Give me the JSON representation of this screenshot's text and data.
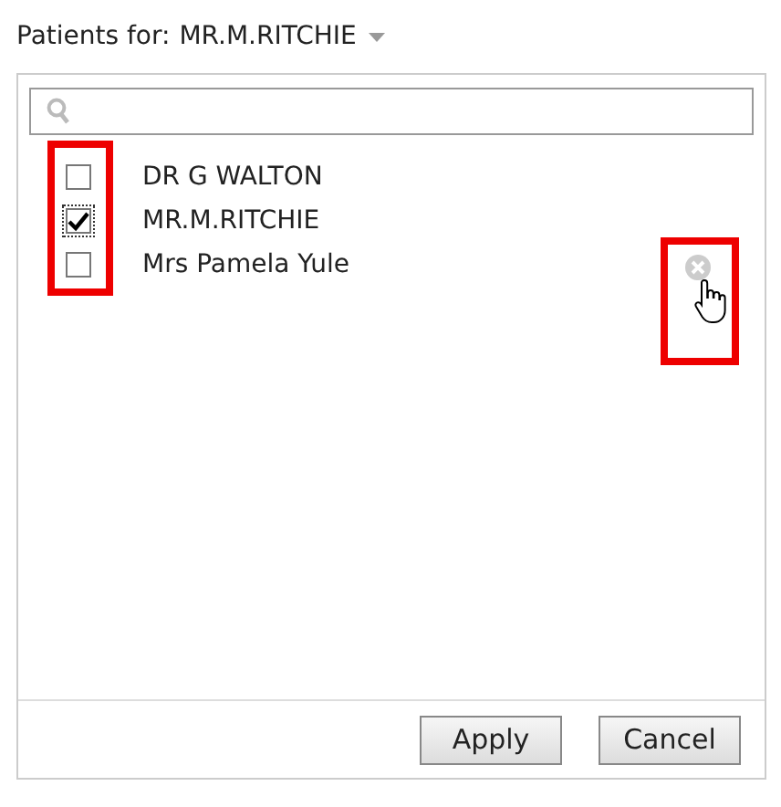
{
  "header": {
    "label": "Patients for:",
    "value": "MR.M.RITCHIE"
  },
  "patients": [
    {
      "name": "DR G WALTON",
      "checked": false
    },
    {
      "name": "MR.M.RITCHIE",
      "checked": true
    },
    {
      "name": "Mrs Pamela Yule",
      "checked": false
    }
  ],
  "buttons": [
    "Apply",
    "Cancel"
  ]
}
